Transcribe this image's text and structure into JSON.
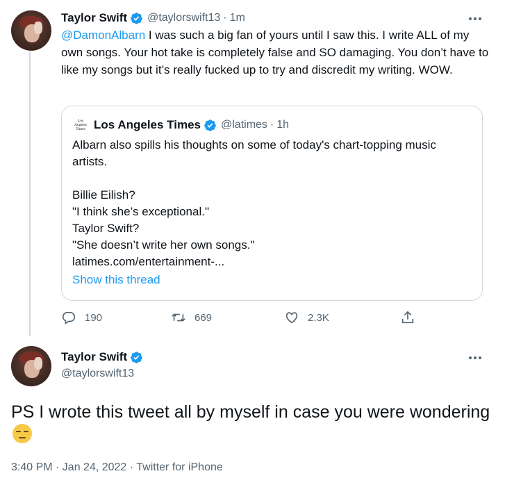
{
  "colors": {
    "link": "#1d9bf0",
    "verified": "#1d9bf0",
    "secondary": "#536471",
    "border": "#cfd9de"
  },
  "reply_tweet": {
    "author": {
      "name": "Taylor Swift",
      "handle": "@taylorswift13",
      "time": "1m"
    },
    "mention": "@DamonAlbarn",
    "text": " I was such a big fan of yours until I saw this. I write ALL of my own songs. Your hot take is completely false and SO damaging. You don’t have to like my songs but it’s really fucked up to try and discredit my writing. WOW.",
    "quoted": {
      "logo_text": "Los Angeles Times",
      "author": {
        "name": "Los Angeles Times",
        "handle": "@latimes",
        "time": "1h"
      },
      "lines": [
        "Albarn also spills his thoughts on some of today's chart-topping music",
        "artists.",
        "",
        "Billie Eilish?",
        "\"I think she’s exceptional.\"",
        "Taylor Swift?",
        "\"She doesn’t write her own songs.\"",
        "latimes.com/entertainment-..."
      ],
      "show_thread": "Show this thread"
    },
    "actions": {
      "replies": "190",
      "retweets": "669",
      "likes": "2.3K"
    }
  },
  "main_tweet": {
    "author": {
      "name": "Taylor Swift",
      "handle": "@taylorswift13"
    },
    "text": "PS I wrote this tweet all by myself in case you were wondering",
    "emoji": "expressionless-face",
    "timestamp": "3:40 PM · Jan 24, 2022 · Twitter for iPhone"
  },
  "icons": [
    "verified-badge",
    "more-options",
    "reply",
    "retweet",
    "like",
    "share"
  ]
}
